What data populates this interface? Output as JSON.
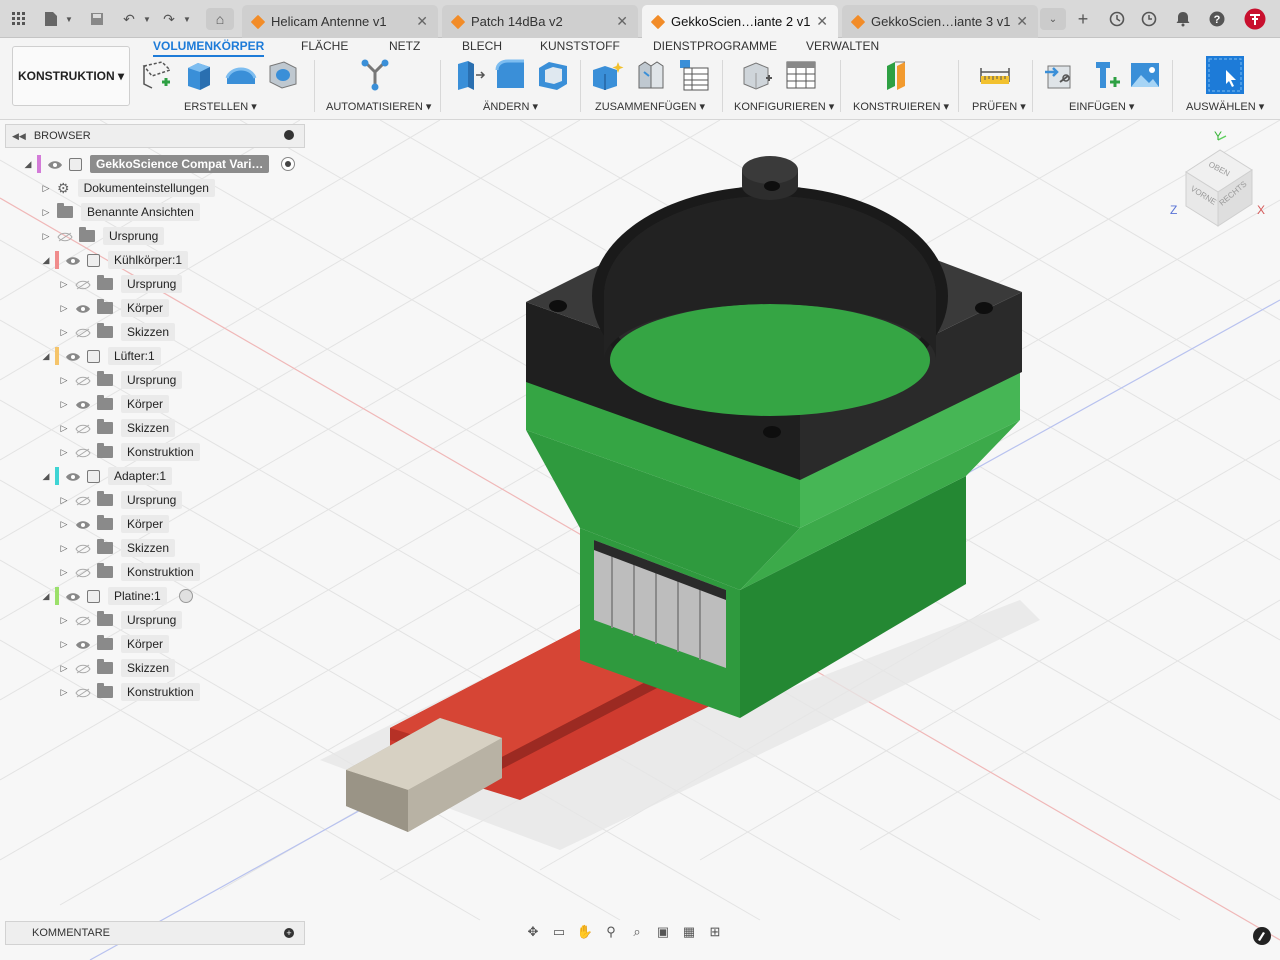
{
  "tabs": [
    {
      "label": "Helicam Antenne v1",
      "active": false
    },
    {
      "label": "Patch 14dBa v2",
      "active": false
    },
    {
      "label": "GekkoScien…iante 2 v1",
      "active": true
    },
    {
      "label": "GekkoScien…iante 3 v1",
      "active": false
    }
  ],
  "toolbar": {
    "workspace": "KONSTRUKTION ▾",
    "ribbon_tabs": [
      "VOLUMENKÖRPER",
      "FLÄCHE",
      "NETZ",
      "BLECH",
      "KUNSTSTOFF",
      "DIENSTPROGRAMME",
      "VERWALTEN"
    ],
    "groups": [
      "ERSTELLEN ▾",
      "AUTOMATISIEREN ▾",
      "ÄNDERN ▾",
      "ZUSAMMENFÜGEN ▾",
      "KONFIGURIEREN ▾",
      "KONSTRUIEREN ▾",
      "PRÜFEN ▾",
      "EINFÜGEN ▾",
      "AUSWÄHLEN ▾"
    ]
  },
  "browser": {
    "title": "BROWSER",
    "root": "GekkoScience Compat Vari…",
    "items": [
      {
        "label": "Dokumenteinstellungen",
        "icon": "gear-icon"
      },
      {
        "label": "Benannte Ansichten",
        "icon": "folder-icon"
      },
      {
        "label": "Ursprung",
        "icon": "folder-icon"
      },
      {
        "label": "Kühlkörper:1",
        "icon": "component-icon",
        "color": "#f08c8c"
      },
      {
        "label": "Ursprung",
        "icon": "folder-icon"
      },
      {
        "label": "Körper",
        "icon": "folder-icon"
      },
      {
        "label": "Skizzen",
        "icon": "folder-icon"
      },
      {
        "label": "Lüfter:1",
        "icon": "component-icon",
        "color": "#f5c46a"
      },
      {
        "label": "Ursprung",
        "icon": "folder-icon"
      },
      {
        "label": "Körper",
        "icon": "folder-icon"
      },
      {
        "label": "Skizzen",
        "icon": "folder-icon"
      },
      {
        "label": "Konstruktion",
        "icon": "folder-icon"
      },
      {
        "label": "Adapter:1",
        "icon": "component-icon",
        "color": "#3ed4d4"
      },
      {
        "label": "Ursprung",
        "icon": "folder-icon"
      },
      {
        "label": "Körper",
        "icon": "folder-icon"
      },
      {
        "label": "Skizzen",
        "icon": "folder-icon"
      },
      {
        "label": "Konstruktion",
        "icon": "folder-icon"
      },
      {
        "label": "Platine:1",
        "icon": "component-icon",
        "color": "#9be06a"
      },
      {
        "label": "Ursprung",
        "icon": "folder-icon"
      },
      {
        "label": "Körper",
        "icon": "folder-icon"
      },
      {
        "label": "Skizzen",
        "icon": "folder-icon"
      },
      {
        "label": "Konstruktion",
        "icon": "folder-icon"
      }
    ]
  },
  "comments": {
    "title": "KOMMENTARE"
  },
  "viewcube": {
    "top": "OBEN",
    "front": "VORNE",
    "right": "RECHTS",
    "axis_x": "X",
    "axis_y": "Y",
    "axis_z": "Z"
  }
}
